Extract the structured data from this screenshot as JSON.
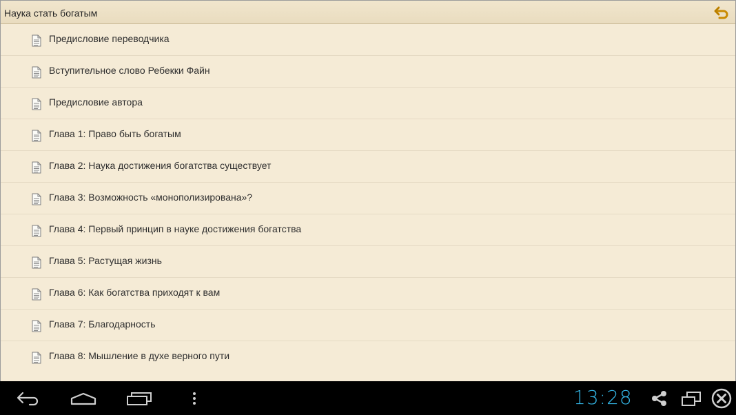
{
  "app": {
    "title": "Наука стать богатым",
    "back_icon": "undo-arrow-icon",
    "colors": {
      "background": "#f5ebd6",
      "titlebar": "#eadcbf",
      "back_icon": "#c98a00"
    }
  },
  "chapters": [
    {
      "label": "Предисловие переводчика",
      "icon": "document-icon"
    },
    {
      "label": "Вступительное слово Ребекки Файн",
      "icon": "document-icon"
    },
    {
      "label": "Предисловие автора",
      "icon": "document-icon"
    },
    {
      "label": "Глава 1: Право быть богатым",
      "icon": "document-icon"
    },
    {
      "label": "Глава 2: Наука достижения богатства существует",
      "icon": "document-icon"
    },
    {
      "label": "Глава 3: Возможность «монополизирована»?",
      "icon": "document-icon"
    },
    {
      "label": "Глава 4: Первый принцип в науке достижения богатства",
      "icon": "document-icon"
    },
    {
      "label": "Глава 5: Растущая жизнь",
      "icon": "document-icon"
    },
    {
      "label": "Глава 6: Как богатства приходят к вам",
      "icon": "document-icon"
    },
    {
      "label": "Глава 7: Благодарность",
      "icon": "document-icon"
    },
    {
      "label": "Глава 8: Мышление в духе верного пути",
      "icon": "document-icon"
    }
  ],
  "system_bar": {
    "clock": "13:28",
    "clock_color": "#33b5e5",
    "icons": [
      "back-icon",
      "home-icon",
      "recent-apps-icon",
      "menu-icon",
      "share-icon",
      "window-icon",
      "close-icon"
    ]
  }
}
